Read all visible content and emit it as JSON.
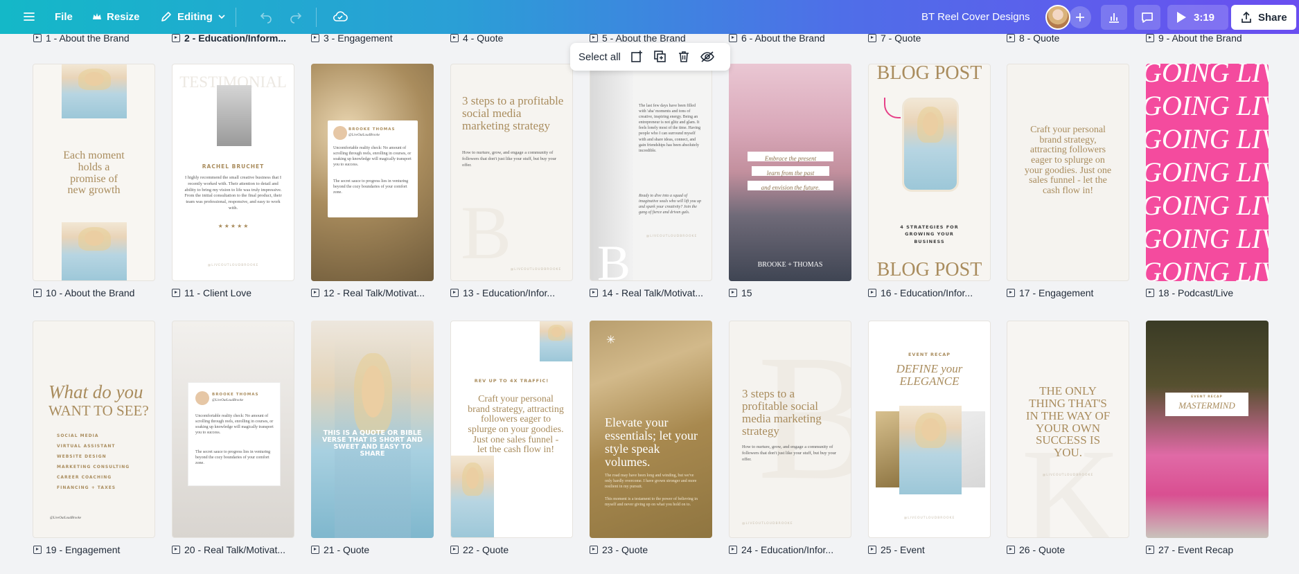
{
  "topbar": {
    "file_label": "File",
    "resize_label": "Resize",
    "editing_label": "Editing",
    "doc_title": "BT Reel Cover Designs",
    "timer": "3:19",
    "share_label": "Share"
  },
  "selection_toolbar": {
    "select_all": "Select all"
  },
  "top_row_labels": [
    "1 - About the Brand",
    "2 - Education/Inform...",
    "3 - Engagement",
    "4 - Quote",
    "5 - About the Brand",
    "6 - About the Brand",
    "7 - Quote",
    "8 - Quote",
    "9 - About the Brand"
  ],
  "row1_labels": [
    "10 - About the Brand",
    "11 - Client Love",
    "12 - Real Talk/Motivat...",
    "13 - Education/Infor...",
    "14 - Real Talk/Motivat...",
    "15",
    "16 - Education/Infor...",
    "17 - Engagement",
    "18 - Podcast/Live"
  ],
  "row2_labels": [
    "19 - Engagement",
    "20 - Real Talk/Motivat...",
    "21 - Quote",
    "22 - Quote",
    "23 - Quote",
    "24 - Education/Infor...",
    "25 - Event",
    "26 - Quote",
    "27 - Event Recap"
  ],
  "cards": {
    "c10": {
      "quote": "Each moment holds a promise of new growth"
    },
    "c11": {
      "header": "TESTIMONIAL",
      "name": "RACHEL BRUCHET",
      "body": "I highly recommend the small creative business that I recently worked with. Their attention to detail and ability to bring my vision to life was truly impressive. From the initial consultation to the final product, their team was professional, responsive, and easy to work with.",
      "stars": "★ ★ ★ ★ ★",
      "handle": "@LIVEOUTLOUDBROOKE"
    },
    "c12": {
      "name": "BROOKE THOMAS",
      "handle": "@LiveOutLoudBrooke",
      "body1": "Uncomfortable reality check: No amount of scrolling through reels, enrolling in courses, or soaking up knowledge will magically transport you to success.",
      "body2": "The secret sauce to progress lies in venturing beyond the cozy boundaries of your comfort zone."
    },
    "c13": {
      "title": "3 steps to a profitable social media marketing strategy",
      "body": "How to nurture, grow, and engage a community of followers that don't just like your stuff, but buy your offer.",
      "handle": "@LIVEOUTLOUDBROOKE"
    },
    "c14": {
      "body1": "The last few days have been filled with 'aha' moments and tons of creative, inspiring energy. Being an entrepreneur is not glitz and glam. It feels lonely most of the time. Having people who I can surround myself with and share ideas, connect, and gain friendships has been absolutely incredible.",
      "body2": "Ready to dive into a squad of imaginative souls who will lift you up and spark your creativity? Join the gang of fierce and driven gals.",
      "handle": "@LIVEOUTLOUDBROOKE"
    },
    "c15": {
      "line1": "Embrace the present",
      "line2": "learn from the past",
      "line3": "and envision the future.",
      "brand": "BROOKE + THOMAS"
    },
    "c16": {
      "header": "BLOG POST",
      "body": "4 STRATEGIES FOR GROWING YOUR BUSINESS",
      "footer": "BLOG POST"
    },
    "c17": {
      "quote": "Craft your personal brand strategy, attracting followers eager to splurge on your goodies. Just one sales funnel - let the cash flow in!"
    },
    "c18": {
      "repeat": "GOING LIVE"
    },
    "c19": {
      "title1": "What do you",
      "title2": "WANT TO SEE?",
      "items": [
        "SOCIAL MEDIA",
        "VIRTUAL ASSISTANT",
        "WEBSITE DESIGN",
        "MARKETING CONSULTING",
        "CAREER COACHING",
        "FINANCING + TAXES"
      ],
      "handle": "@LiveOutLoudBrooke"
    },
    "c20": {
      "name": "BROOKE THOMAS",
      "handle": "@LiveOutLoudBrooke",
      "body1": "Uncomfortable reality check: No amount of scrolling through reels, enrolling in courses, or soaking up knowledge will magically transport you to success.",
      "body2": "The secret sauce to progress lies in venturing beyond the cozy boundaries of your comfort zone."
    },
    "c21": {
      "quote": "THIS IS A QUOTE OR BIBLE VERSE THAT IS SHORT AND SWEET AND EASY TO SHARE"
    },
    "c22": {
      "header": "REV UP TO 4X TRAFFIC!",
      "quote": "Craft your personal brand strategy, attracting followers eager to splurge on your goodies. Just one sales funnel - let the cash flow in!"
    },
    "c23": {
      "quote": "Elevate your essentials; let your style speak volumes.",
      "body1": "The road may have been long and winding, but we've only hardly overcome. I have grown stronger and more resilient in my pursuit.",
      "body2": "This moment is a testament to the power of believing in myself and never giving up on what you hold on to."
    },
    "c24": {
      "title": "3 steps to a profitable social media marketing strategy",
      "body": "How to nurture, grow, and engage a community of followers that don't just like your stuff, but buy your offer.",
      "handle": "@LIVEOUTLOUDBROOKE"
    },
    "c25": {
      "header": "EVENT RECAP",
      "title": "DEFINE your ELEGANCE",
      "handle": "@LIVEOUTLOUDBROOKE"
    },
    "c26": {
      "quote": "THE ONLY THING THAT'S IN THE WAY OF YOUR OWN SUCCESS IS YOU.",
      "handle": "@LIVEOUTLOUDBROOKE"
    },
    "c27": {
      "header": "EVENT RECAP",
      "title": "MASTERMIND"
    }
  }
}
